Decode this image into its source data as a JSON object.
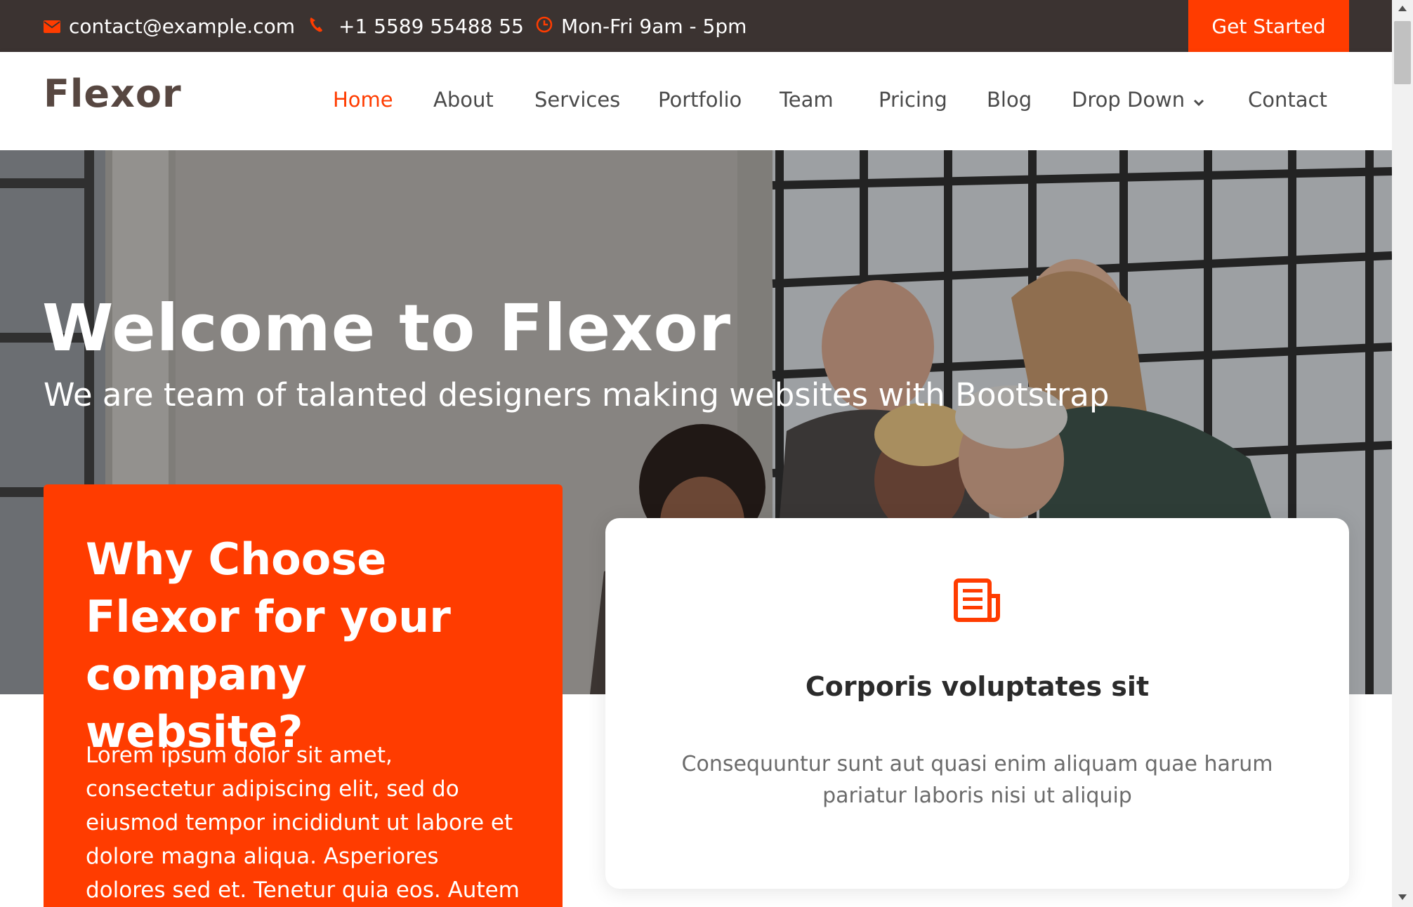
{
  "topbar": {
    "email": "contact@example.com",
    "phone": "+1 5589 55488 55",
    "hours": "Mon-Fri 9am - 5pm",
    "cta": "Get Started",
    "icons": [
      "envelope-icon",
      "phone-icon",
      "clock-icon"
    ]
  },
  "header": {
    "logo": "Flexor",
    "nav": [
      {
        "label": "Home",
        "active": true
      },
      {
        "label": "About"
      },
      {
        "label": "Services"
      },
      {
        "label": "Portfolio"
      },
      {
        "label": "Team"
      },
      {
        "label": "Pricing"
      },
      {
        "label": "Blog"
      },
      {
        "label": "Drop Down",
        "dropdown": true
      },
      {
        "label": "Contact"
      }
    ]
  },
  "hero": {
    "title": "Welcome to Flexor",
    "subtitle": "We are team of talanted designers making websites with Bootstrap"
  },
  "why": {
    "title": "Why Choose Flexor for your company website?",
    "text": "Lorem ipsum dolor sit amet, consectetur adipiscing elit, sed do eiusmod tempor incididunt ut labore et dolore magna aliqua. Asperiores dolores sed et. Tenetur quia eos. Autem tempore"
  },
  "card": {
    "icon": "receipt-icon",
    "title": "Corporis voluptates sit",
    "text": "Consequuntur sunt aut quasi enim aliquam quae harum pariatur laboris nisi ut aliquip"
  },
  "colors": {
    "accent": "#ff3c00",
    "topbar": "#3b3331",
    "logo": "#574741"
  }
}
